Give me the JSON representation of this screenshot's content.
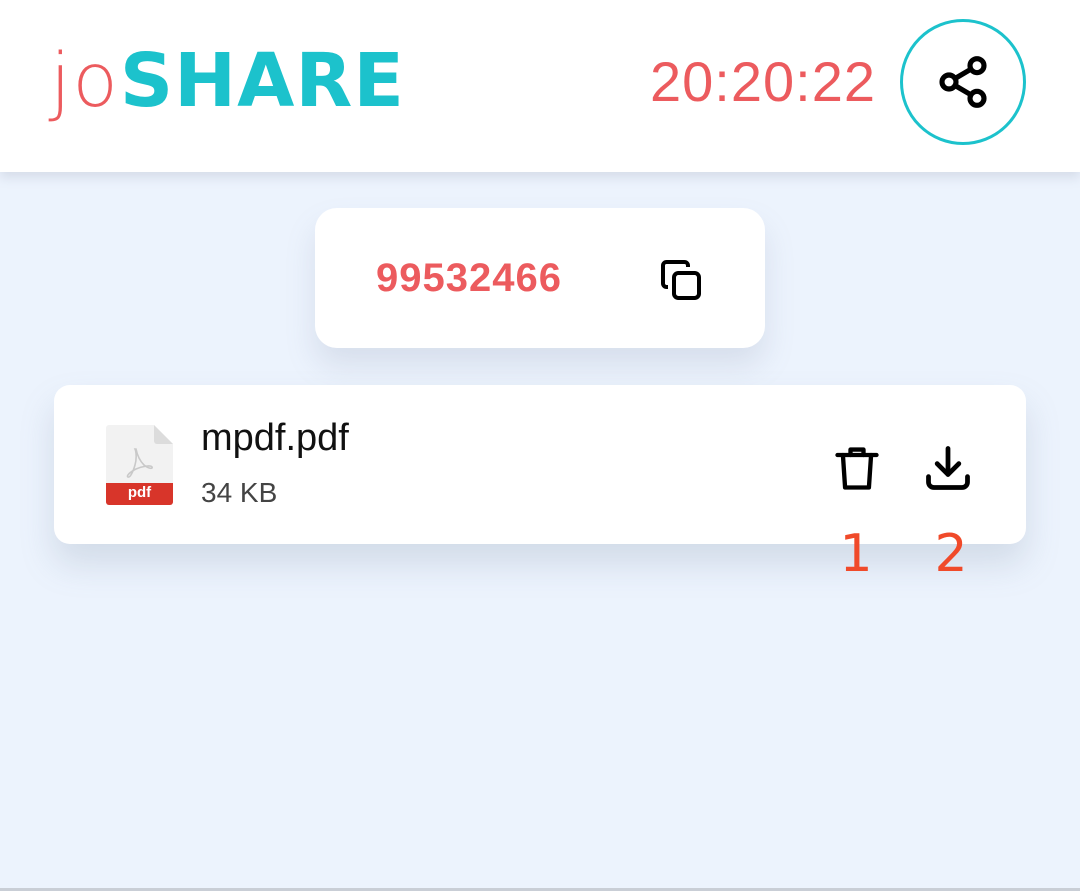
{
  "header": {
    "logo_part1": "jo",
    "logo_part2": "SHARE",
    "clock": "20:20:22"
  },
  "share_code": {
    "code": "99532466"
  },
  "file": {
    "name": "mpdf.pdf",
    "size": "34 KB",
    "type_label": "pdf"
  },
  "annotations": {
    "delete_marker": "1",
    "download_marker": "2"
  },
  "icons": {
    "share": "share-icon",
    "copy": "copy-icon",
    "trash": "trash-icon",
    "download": "download-icon",
    "file": "pdf-file-icon"
  },
  "colors": {
    "accent_red": "#ec5b5e",
    "accent_teal": "#1cc2cc",
    "background": "#ecf3fd",
    "marker": "#f04a2a"
  }
}
